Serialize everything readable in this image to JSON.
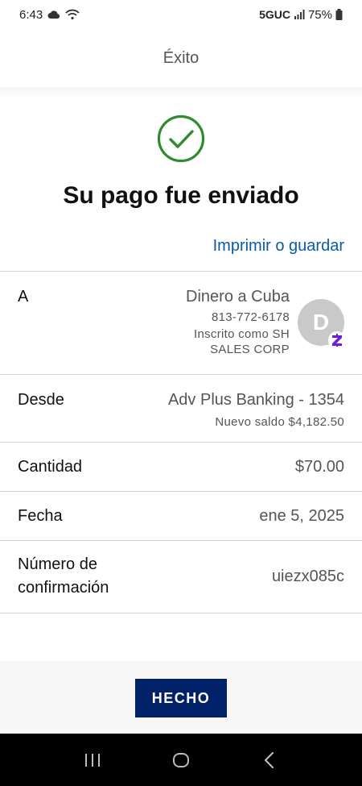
{
  "status_bar": {
    "time": "6:43",
    "network": "5GUC",
    "battery": "75%"
  },
  "header": {
    "title": "Éxito"
  },
  "success": {
    "headline": "Su pago fue enviado",
    "print_link": "Imprimir o guardar",
    "check_color": "#2e8b2e"
  },
  "details": {
    "to": {
      "label": "A",
      "name": "Dinero a Cuba",
      "phone": "813-772-6178",
      "enrolled_line1": "Inscrito como SH",
      "enrolled_line2": "SALES CORP",
      "avatar_initial": "D"
    },
    "from": {
      "label": "Desde",
      "account": "Adv Plus Banking - 1354",
      "balance": "Nuevo saldo $4,182.50"
    },
    "amount": {
      "label": "Cantidad",
      "value": "$70.00"
    },
    "date": {
      "label": "Fecha",
      "value": "ene 5, 2025"
    },
    "confirmation": {
      "label_line1": "Número de",
      "label_line2": "confirmación",
      "value": "uiezx085c"
    }
  },
  "actions": {
    "done_label": "HECHO",
    "done_color": "#012169"
  },
  "icons": {
    "success": "check-circle-icon",
    "zelle": "zelle-icon",
    "recents": "recent-apps-icon",
    "home": "home-icon",
    "back": "back-icon"
  }
}
